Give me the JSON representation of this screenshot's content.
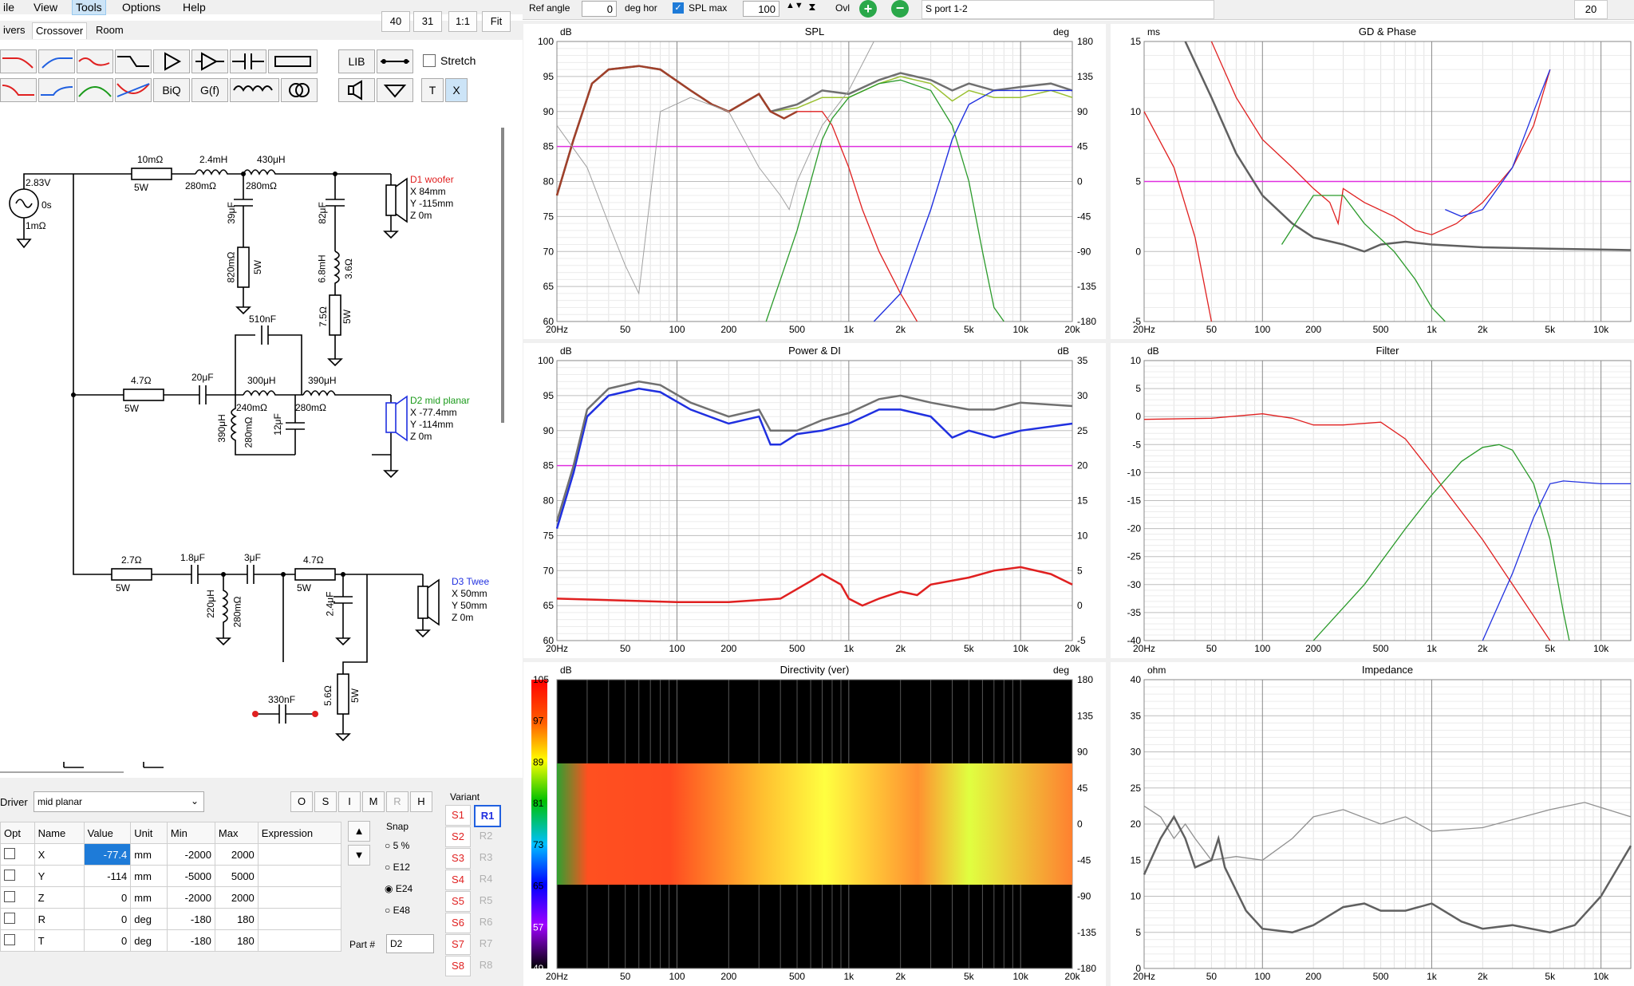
{
  "menu": {
    "items": [
      "ile",
      "View",
      "Tools",
      "Options",
      "Help"
    ],
    "active": "Tools"
  },
  "left_tabs": [
    "ivers",
    "Crossover",
    "Room"
  ],
  "left_toolbar": {
    "b40": "40",
    "b31": "31",
    "b11": "1:1",
    "fit": "Fit"
  },
  "crossover_buttons": {
    "lib": "LIB",
    "biq": "BiQ",
    "gf": "G(f)",
    "stretch": "Stretch",
    "t": "T",
    "x": "X"
  },
  "toolbar": {
    "ref_angle_label": "Ref angle",
    "ref_angle_value": "0",
    "deg_hor": "deg hor",
    "spl_max_label": "SPL max",
    "spl_max_value": "100",
    "ovl": "Ovl",
    "project": "S port 1-2",
    "right_value": "20"
  },
  "schematic": {
    "source": {
      "voltage": "2.83V",
      "delay": "0s",
      "resistance": "1mΩ"
    },
    "woofer": {
      "r1": "10mΩ",
      "r1w": "5W",
      "l1": "2.4mH",
      "l1r": "280mΩ",
      "l2": "430μH",
      "l2r": "280mΩ",
      "c1": "39μF",
      "r2": "820mΩ",
      "r2w": "5W",
      "c2": "82μF",
      "l3": "6.8mH",
      "l3r": "3.6Ω",
      "r3": "7.5Ω",
      "r3w": "5W",
      "name": "D1 woofer",
      "x": "X 84mm",
      "y": "Y -115mm",
      "z": "Z 0m"
    },
    "mid": {
      "c_top": "510nF",
      "r1": "4.7Ω",
      "r1w": "5W",
      "c1": "20μF",
      "l1": "300μH",
      "l1r": "240mΩ",
      "l2": "390μH",
      "l2r": "280mΩ",
      "l3": "390μH",
      "l3r": "280mΩ",
      "c2": "12μF",
      "name": "D2 mid planar",
      "x": "X -77.4mm",
      "y": "Y -114mm",
      "z": "Z 0m"
    },
    "tweeter": {
      "r1": "2.7Ω",
      "r1w": "5W",
      "c1": "1.8μF",
      "c2": "3μF",
      "r2": "4.7Ω",
      "r2w": "5W",
      "l1": "220μH",
      "l1r": "280mΩ",
      "c3": "2.4μF",
      "r3": "5.6Ω",
      "r3w": "5W",
      "c_float": "330nF",
      "name": "D3 Twee",
      "x": "X 50mm",
      "y": "Y 50mm",
      "z": "Z 0m"
    }
  },
  "driver_panel": {
    "label": "Driver",
    "selected": "mid planar",
    "buttons": [
      "O",
      "S",
      "I",
      "M",
      "R",
      "H"
    ]
  },
  "param_table": {
    "headers": [
      "Opt",
      "Name",
      "Value",
      "Unit",
      "Min",
      "Max",
      "Expression"
    ],
    "rows": [
      {
        "name": "X",
        "value": "-77.4",
        "unit": "mm",
        "min": "-2000",
        "max": "2000"
      },
      {
        "name": "Y",
        "value": "-114",
        "unit": "mm",
        "min": "-5000",
        "max": "5000"
      },
      {
        "name": "Z",
        "value": "0",
        "unit": "mm",
        "min": "-2000",
        "max": "2000"
      },
      {
        "name": "R",
        "value": "0",
        "unit": "deg",
        "min": "-180",
        "max": "180"
      },
      {
        "name": "T",
        "value": "0",
        "unit": "deg",
        "min": "-180",
        "max": "180"
      }
    ]
  },
  "snap": {
    "label": "Snap",
    "options": [
      "5 %",
      "E12",
      "E24",
      "E48"
    ],
    "selected": "E24"
  },
  "part": {
    "label": "Part #",
    "value": "D2"
  },
  "variant": {
    "label": "Variant",
    "s": [
      "S1",
      "S2",
      "S3",
      "S4",
      "S5",
      "S6",
      "S7",
      "S8"
    ],
    "r": [
      "R1",
      "R2",
      "R3",
      "R4",
      "R5",
      "R6",
      "R7",
      "R8"
    ],
    "selected": "R1"
  },
  "x_ticks": [
    "20Hz",
    "50",
    "100",
    "200",
    "500",
    "1k",
    "2k",
    "5k",
    "10k",
    "20k"
  ],
  "x_ticks_short": [
    "20Hz",
    "50",
    "100",
    "200",
    "500",
    "1k",
    "2k",
    "5k",
    "10k"
  ],
  "colors": {
    "red": "#e02020",
    "green": "#2a9a2a",
    "blue": "#2030e0",
    "gray": "#707070",
    "magenta": "#e030e0",
    "brown": "#a0402a",
    "lime": "#9ac030"
  },
  "charts": {
    "spl": {
      "title": "SPL",
      "yunit": "dB",
      "y2unit": "deg",
      "yticks": [
        "100",
        "95",
        "90",
        "85",
        "80",
        "75",
        "70",
        "65",
        "60"
      ],
      "y2ticks": [
        "180",
        "135",
        "90",
        "45",
        "0",
        "-45",
        "-90",
        "-135",
        "-180"
      ]
    },
    "gd": {
      "title": "GD & Phase",
      "yunit": "ms",
      "yticks": [
        "15",
        "10",
        "5",
        "0",
        "-5"
      ]
    },
    "power": {
      "title": "Power & DI",
      "yunit": "dB",
      "y2unit": "dB",
      "yticks": [
        "100",
        "95",
        "90",
        "85",
        "80",
        "75",
        "70",
        "65",
        "60"
      ],
      "y2ticks": [
        "35",
        "30",
        "25",
        "20",
        "15",
        "10",
        "5",
        "0",
        "-5"
      ]
    },
    "filter": {
      "title": "Filter",
      "yunit": "dB",
      "yticks": [
        "10",
        "5",
        "0",
        "-5",
        "-10",
        "-15",
        "-20",
        "-25",
        "-30",
        "-35",
        "-40"
      ]
    },
    "directivity": {
      "title": "Directivity (ver)",
      "yunit": "dB",
      "y2unit": "deg",
      "scale": [
        "105",
        "97",
        "89",
        "81",
        "73",
        "65",
        "57",
        "49"
      ],
      "y2ticks": [
        "180",
        "135",
        "90",
        "45",
        "0",
        "-45",
        "-90",
        "-135",
        "-180"
      ]
    },
    "impedance": {
      "title": "Impedance",
      "yunit": "ohm",
      "yticks": [
        "40",
        "35",
        "30",
        "25",
        "20",
        "15",
        "10",
        "5",
        "0"
      ]
    }
  }
}
